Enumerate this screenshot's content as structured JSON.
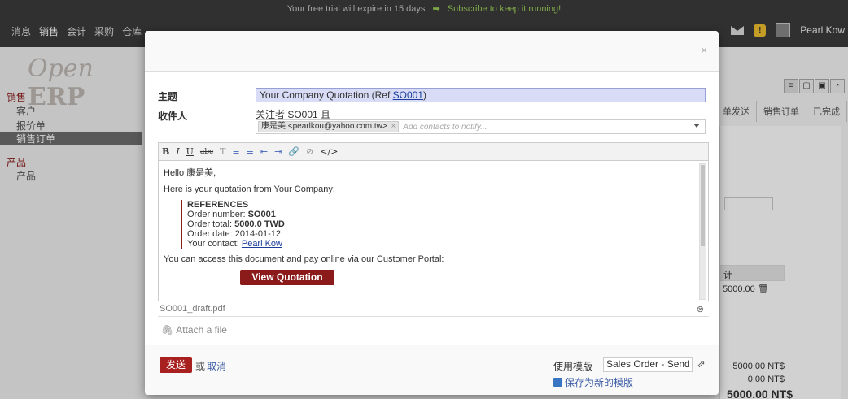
{
  "trial": {
    "message": "Your free trial will expire in 15 days",
    "arrow": "➡",
    "subscribe": "Subscribe to keep it running!"
  },
  "topmenu": [
    "消息",
    "销售",
    "会计",
    "采购",
    "仓库"
  ],
  "topmenu_active": "销售",
  "user": {
    "name": "Pearl Kow"
  },
  "logo": {
    "open": "Open",
    "erp": "ERP"
  },
  "sidebar": {
    "sales_heading": "销售",
    "sales_items": [
      "客户",
      "报价单",
      "销售订单"
    ],
    "active_item": "销售订单",
    "products_heading": "产品",
    "product_items": [
      "产品"
    ]
  },
  "background": {
    "status_steps": [
      "单发送",
      "销售订单",
      "已完成"
    ],
    "table_header": "计",
    "line_total": "5000.00",
    "total_untaxed": "5000.00 NT$",
    "total_tax": "0.00 NT$",
    "total_grand": "5000.00 NT$"
  },
  "modal": {
    "close": "×",
    "subject_label": "主题",
    "subject_prefix": "Your Company Quotation (Ref ",
    "subject_ref": "SO001",
    "subject_suffix": ")",
    "recipients_label": "收件人",
    "followers_text": "关注者 SO001 且",
    "partner_tag": "康是美 <pearlkou@yahoo.com.tw>",
    "partner_tag_remove": "×",
    "partner_placeholder": "Add contacts to notify...",
    "toolbar": [
      "B",
      "I",
      "U",
      "abc",
      "T",
      "≡",
      "≡",
      "⇤",
      "⇥",
      "🔗",
      "⊘",
      "</>"
    ],
    "body": {
      "greeting": "Hello 康是美,",
      "intro": "Here is your quotation from Your Company:",
      "ref_heading": "REFERENCES",
      "order_number_label": "Order number: ",
      "order_number": "SO001",
      "order_total_label": "Order total: ",
      "order_total": "5000.0 TWD",
      "order_date": "Order date: 2014-01-12",
      "contact_label": "Your contact: ",
      "contact_name": "Pearl Kow",
      "portal_text": "You can access this document and pay online via our Customer Portal:",
      "view_button": "View Quotation"
    },
    "attachment": "SO001_draft.pdf",
    "attachment_remove": "⊗",
    "attach_link": "Attach a file",
    "footer": {
      "send": "发送",
      "or": "或",
      "cancel": "取消",
      "template_label": "使用模版",
      "template_value": "Sales Order - Send by E▾",
      "save_template": "保存为新的模版"
    }
  },
  "colors": {
    "brand_red": "#8b1a1a",
    "send_red": "#a82020",
    "link_blue": "#3c5ca5",
    "subscribe_green": "#9ccf5a"
  }
}
